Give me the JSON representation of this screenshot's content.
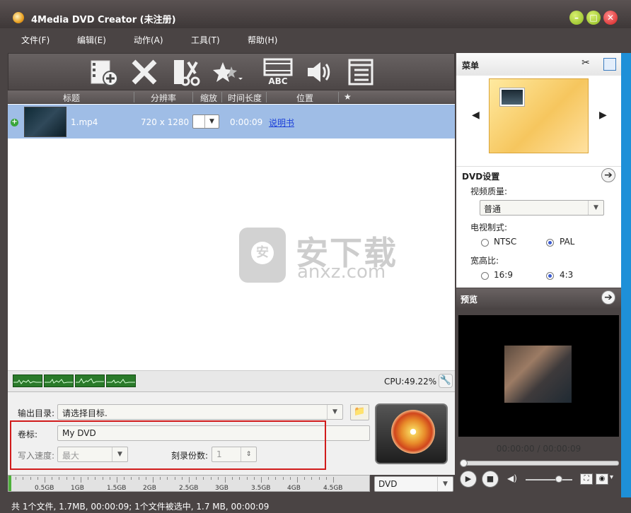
{
  "window": {
    "title": "4Media DVD Creator (未注册)",
    "min": "–",
    "max": "□",
    "close": "✕"
  },
  "menubar": [
    "文件(F)",
    "编辑(E)",
    "动作(A)",
    "工具(T)",
    "帮助(H)"
  ],
  "toolbar": {
    "icons": [
      "add-video-icon",
      "delete-icon",
      "clip-icon",
      "effects-icon",
      "subtitle-icon",
      "audio-icon",
      "chapter-icon"
    ],
    "subtitle_label": "ABC"
  },
  "columns": {
    "title": "标题",
    "resolution": "分辨率",
    "zoom": "缩放",
    "duration": "时间长度",
    "position": "位置",
    "star": "★"
  },
  "files": [
    {
      "name": "1.mp4",
      "resolution": "720 x 1280",
      "duration": "0:00:09",
      "link": "说明书"
    }
  ],
  "watermark": {
    "cn": "安下载",
    "en": "anxz.com",
    "glyph": "安"
  },
  "cpu": {
    "label": "CPU:49.22%"
  },
  "output": {
    "label": "输出目录:",
    "value": "请选择目标."
  },
  "volume": {
    "label": "卷标:",
    "value": "My DVD"
  },
  "speed": {
    "label": "写入速度:",
    "value": "最大"
  },
  "copies": {
    "label": "刻录份数:",
    "value": "1"
  },
  "disc": {
    "ticks": [
      "0.5GB",
      "1GB",
      "1.5GB",
      "2GB",
      "2.5GB",
      "3GB",
      "3.5GB",
      "4GB",
      "4.5GB"
    ],
    "type": "DVD"
  },
  "status": "共 1个文件, 1.7MB,  00:00:09; 1个文件被选中, 1.7 MB,  00:00:09",
  "right": {
    "menu_title": "菜单",
    "dvd_title": "DVD设置",
    "quality_label": "视频质量:",
    "quality_value": "普通",
    "tv_label": "电视制式:",
    "ntsc": "NTSC",
    "pal": "PAL",
    "aspect_label": "宽高比:",
    "r169": "16:9",
    "r43": "4:3"
  },
  "preview": {
    "title": "预览",
    "time": "00:00:00 / 00:00:09"
  }
}
